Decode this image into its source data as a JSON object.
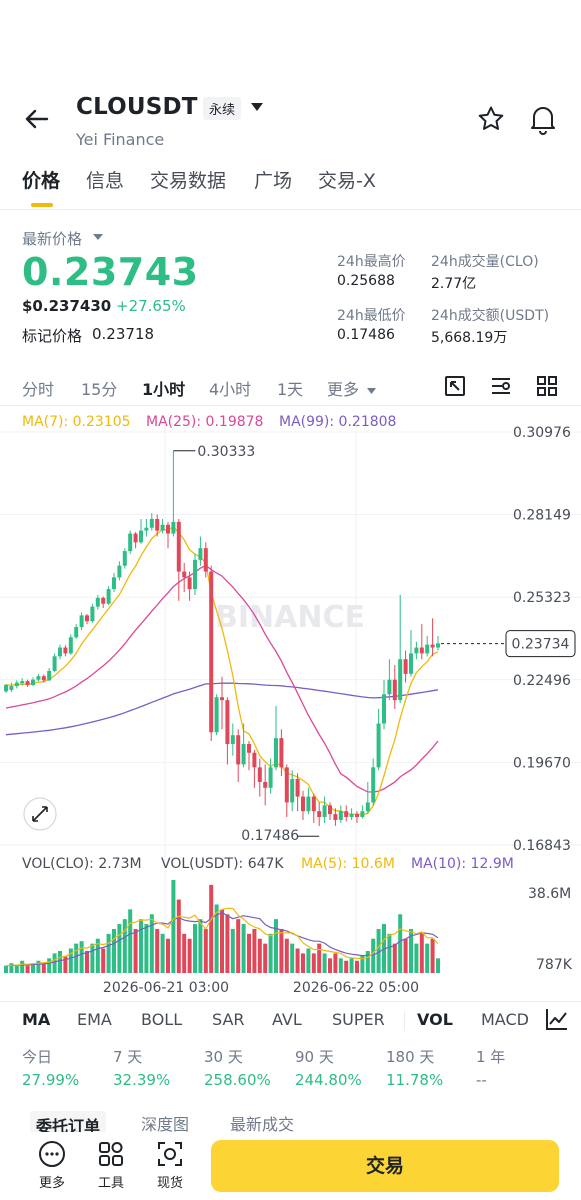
{
  "header": {
    "symbol": "CLOUSDT",
    "badge": "永续",
    "subname": "Yei Finance"
  },
  "tabs": [
    "价格",
    "信息",
    "交易数据",
    "广场",
    "交易-X"
  ],
  "price": {
    "latest_label": "最新价格",
    "last": "0.23743",
    "usd": "$0.237430",
    "change_pct": "+27.65%",
    "mark_label": "标记价格",
    "mark_value": "0.23718"
  },
  "stats": {
    "high_label": "24h最高价",
    "high_value": "0.25688",
    "vol_clo_label": "24h成交量(CLO)",
    "vol_clo_value": "2.77亿",
    "low_label": "24h最低价",
    "low_value": "0.17486",
    "vol_usdt_label": "24h成交额(USDT)",
    "vol_usdt_value": "5,668.19万"
  },
  "intervals": [
    "分时",
    "15分",
    "1小时",
    "4小时",
    "1天",
    "更多"
  ],
  "ma_legend": {
    "ma7": "MA(7): 0.23105",
    "ma25": "MA(25): 0.19878",
    "ma99": "MA(99): 0.21808"
  },
  "vol_legend": {
    "vol_clo": "VOL(CLO): 2.73M",
    "vol_usdt": "VOL(USDT): 647K",
    "ma5": "MA(5): 10.6M",
    "ma10": "MA(10): 12.9M"
  },
  "colors": {
    "up": "#2ebd85",
    "down": "#e0485a",
    "ma7": "#f0b90b",
    "ma25": "#d9489a",
    "ma99": "#7b5cc4",
    "accent": "#fcd535"
  },
  "chart_data": {
    "type": "candlestick",
    "price_axis_labels": [
      "0.30976",
      "0.28149",
      "0.25323",
      "0.22496",
      "0.19670",
      "0.16843"
    ],
    "price_ticks": [
      0.30976,
      0.28149,
      0.25323,
      0.22496,
      0.1967,
      0.16843
    ],
    "current_price_tag": "0.23734",
    "current_price": 0.23734,
    "high_marker": "0.30333",
    "high_value": 0.30333,
    "low_marker": "0.17486",
    "low_value": 0.17486,
    "volume_axis_labels": [
      "38.6M",
      "787K"
    ],
    "time_labels": [
      "2026-06-21 03:00",
      "2026-06-22 05:00"
    ],
    "watermark": "BINANCE",
    "candles": [
      [
        0.221,
        0.2232,
        0.2235,
        0.2205
      ],
      [
        0.2215,
        0.2228,
        0.224,
        0.2208
      ],
      [
        0.2228,
        0.224,
        0.2248,
        0.222
      ],
      [
        0.2238,
        0.2245,
        0.2255,
        0.223
      ],
      [
        0.2245,
        0.2232,
        0.225,
        0.2225
      ],
      [
        0.2232,
        0.225,
        0.2258,
        0.2228
      ],
      [
        0.225,
        0.2262,
        0.227,
        0.2245
      ],
      [
        0.2262,
        0.2248,
        0.2268,
        0.224
      ],
      [
        0.2248,
        0.228,
        0.229,
        0.2245
      ],
      [
        0.228,
        0.233,
        0.234,
        0.2275
      ],
      [
        0.233,
        0.236,
        0.237,
        0.232
      ],
      [
        0.236,
        0.234,
        0.2368,
        0.233
      ],
      [
        0.234,
        0.2395,
        0.2405,
        0.2335
      ],
      [
        0.2395,
        0.243,
        0.244,
        0.239
      ],
      [
        0.243,
        0.247,
        0.248,
        0.242
      ],
      [
        0.247,
        0.245,
        0.2475,
        0.244
      ],
      [
        0.245,
        0.25,
        0.251,
        0.2445
      ],
      [
        0.25,
        0.253,
        0.254,
        0.249
      ],
      [
        0.253,
        0.251,
        0.2535,
        0.2495
      ],
      [
        0.251,
        0.256,
        0.257,
        0.2505
      ],
      [
        0.256,
        0.26,
        0.2615,
        0.255
      ],
      [
        0.26,
        0.264,
        0.2655,
        0.259
      ],
      [
        0.264,
        0.269,
        0.27,
        0.263
      ],
      [
        0.269,
        0.275,
        0.276,
        0.268
      ],
      [
        0.275,
        0.272,
        0.2755,
        0.27
      ],
      [
        0.272,
        0.276,
        0.28,
        0.2715
      ],
      [
        0.276,
        0.277,
        0.28,
        0.274
      ],
      [
        0.277,
        0.28,
        0.282,
        0.276
      ],
      [
        0.28,
        0.276,
        0.2815,
        0.274
      ],
      [
        0.276,
        0.278,
        0.28,
        0.275
      ],
      [
        0.278,
        0.275,
        0.279,
        0.27
      ],
      [
        0.275,
        0.279,
        0.3033,
        0.274
      ],
      [
        0.279,
        0.262,
        0.28,
        0.252
      ],
      [
        0.262,
        0.26,
        0.265,
        0.255
      ],
      [
        0.26,
        0.256,
        0.262,
        0.252
      ],
      [
        0.256,
        0.266,
        0.268,
        0.254
      ],
      [
        0.266,
        0.27,
        0.274,
        0.264
      ],
      [
        0.27,
        0.262,
        0.272,
        0.26
      ],
      [
        0.262,
        0.207,
        0.264,
        0.204
      ],
      [
        0.207,
        0.219,
        0.22,
        0.206
      ],
      [
        0.219,
        0.218,
        0.226,
        0.208
      ],
      [
        0.218,
        0.203,
        0.219,
        0.196
      ],
      [
        0.203,
        0.206,
        0.21,
        0.199
      ],
      [
        0.206,
        0.196,
        0.208,
        0.19
      ],
      [
        0.196,
        0.203,
        0.21,
        0.195
      ],
      [
        0.203,
        0.2,
        0.204,
        0.194
      ],
      [
        0.2,
        0.195,
        0.201,
        0.188
      ],
      [
        0.195,
        0.19,
        0.198,
        0.185
      ],
      [
        0.19,
        0.188,
        0.196,
        0.182
      ],
      [
        0.188,
        0.195,
        0.198,
        0.186
      ],
      [
        0.195,
        0.205,
        0.216,
        0.194
      ],
      [
        0.205,
        0.195,
        0.208,
        0.192
      ],
      [
        0.195,
        0.183,
        0.196,
        0.178
      ],
      [
        0.183,
        0.191,
        0.194,
        0.18
      ],
      [
        0.191,
        0.185,
        0.193,
        0.18
      ],
      [
        0.185,
        0.18,
        0.187,
        0.177
      ],
      [
        0.18,
        0.185,
        0.188,
        0.179
      ],
      [
        0.185,
        0.18,
        0.186,
        0.176
      ],
      [
        0.18,
        0.178,
        0.183,
        0.1749
      ],
      [
        0.178,
        0.182,
        0.185,
        0.176
      ],
      [
        0.182,
        0.179,
        0.183,
        0.177
      ],
      [
        0.179,
        0.177,
        0.181,
        0.175
      ],
      [
        0.177,
        0.18,
        0.182,
        0.176
      ],
      [
        0.18,
        0.178,
        0.182,
        0.1765
      ],
      [
        0.178,
        0.179,
        0.181,
        0.177
      ],
      [
        0.179,
        0.178,
        0.18,
        0.176
      ],
      [
        0.178,
        0.18,
        0.182,
        0.1775
      ],
      [
        0.18,
        0.183,
        0.19,
        0.179
      ],
      [
        0.183,
        0.195,
        0.198,
        0.182
      ],
      [
        0.195,
        0.21,
        0.215,
        0.194
      ],
      [
        0.21,
        0.22,
        0.225,
        0.208
      ],
      [
        0.22,
        0.225,
        0.232,
        0.218
      ],
      [
        0.225,
        0.218,
        0.23,
        0.215
      ],
      [
        0.218,
        0.232,
        0.254,
        0.217
      ],
      [
        0.232,
        0.227,
        0.235,
        0.224
      ],
      [
        0.227,
        0.234,
        0.242,
        0.226
      ],
      [
        0.234,
        0.236,
        0.238,
        0.232
      ],
      [
        0.236,
        0.234,
        0.244,
        0.232
      ],
      [
        0.234,
        0.237,
        0.24,
        0.233
      ],
      [
        0.237,
        0.236,
        0.246,
        0.233
      ],
      [
        0.236,
        0.2374,
        0.24,
        0.235
      ]
    ],
    "volumes": [
      3,
      4,
      3,
      5,
      3,
      4,
      5,
      4,
      6,
      8,
      9,
      7,
      10,
      12,
      13,
      9,
      12,
      14,
      10,
      16,
      18,
      20,
      22,
      26,
      18,
      22,
      20,
      24,
      18,
      16,
      14,
      38,
      30,
      16,
      14,
      20,
      22,
      18,
      36,
      28,
      26,
      24,
      18,
      22,
      20,
      16,
      18,
      14,
      12,
      16,
      22,
      18,
      14,
      12,
      10,
      8,
      10,
      8,
      12,
      8,
      6,
      8,
      6,
      5,
      6,
      5,
      7,
      9,
      14,
      18,
      20,
      16,
      12,
      24,
      14,
      18,
      12,
      16,
      12,
      14,
      6
    ]
  },
  "indicators": [
    "MA",
    "EMA",
    "BOLL",
    "SAR",
    "AVL",
    "SUPER",
    "VOL",
    "MACD"
  ],
  "performance": [
    {
      "label": "今日",
      "value": "27.99%"
    },
    {
      "label": "7 天",
      "value": "32.39%"
    },
    {
      "label": "30 天",
      "value": "258.60%"
    },
    {
      "label": "90 天",
      "value": "244.80%"
    },
    {
      "label": "180 天",
      "value": "11.78%"
    },
    {
      "label": "1 年",
      "value": "--"
    }
  ],
  "orderbook_tabs": [
    "委托订单",
    "深度图",
    "最新成交"
  ],
  "bottom": {
    "more": "更多",
    "tools": "工具",
    "spot": "现货",
    "trade": "交易"
  }
}
